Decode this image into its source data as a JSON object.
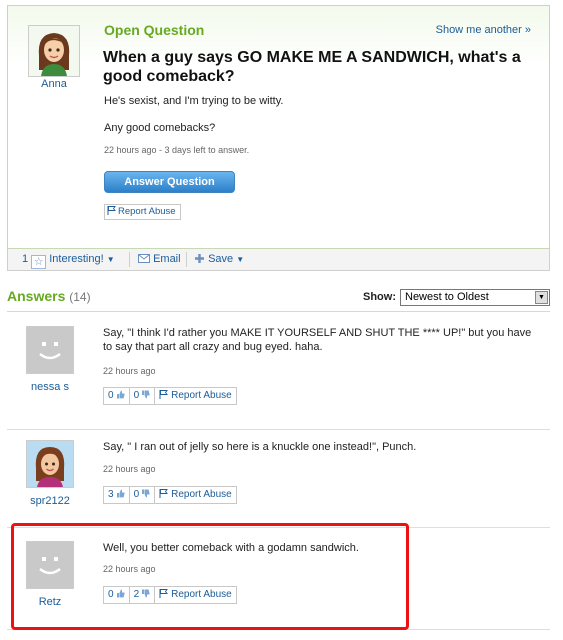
{
  "question": {
    "label": "Open Question",
    "show_another": "Show me another »",
    "asker": "Anna",
    "title": "When a guy says GO MAKE ME A SANDWICH, what's a good comeback?",
    "body_line1": "He's sexist, and I'm trying to be witty.",
    "body_line2": "Any good comebacks?",
    "meta": "22 hours ago - 3 days left to answer.",
    "answer_button": "Answer Question",
    "report": "Report Abuse"
  },
  "actions": {
    "interesting_count": "1",
    "interesting": "Interesting!",
    "email": "Email",
    "save": "Save"
  },
  "answers_header": {
    "title": "Answers",
    "count": "(14)",
    "show_label": "Show:",
    "sort_selected": "Newest to Oldest"
  },
  "answers": [
    {
      "user": "nessa s",
      "text": "Say, \"I think I'd rather you MAKE IT YOURSELF AND SHUT THE **** UP!\" but you have to say that part all crazy and bug eyed. haha.",
      "time": "22 hours ago",
      "thumbs_up": "0",
      "thumbs_down": "0",
      "report": "Report Abuse"
    },
    {
      "user": "spr2122",
      "text": "Say, \" I ran out of jelly so here is a knuckle one instead!\", Punch.",
      "time": "22 hours ago",
      "thumbs_up": "3",
      "thumbs_down": "0",
      "report": "Report Abuse"
    },
    {
      "user": "Retz",
      "text": "Well, you better comeback with a godamn sandwich.",
      "time": "22 hours ago",
      "thumbs_up": "0",
      "thumbs_down": "2",
      "report": "Report Abuse"
    }
  ],
  "colors": {
    "accent_green": "#66aa22",
    "link_blue": "#1b5c99",
    "highlight_red": "#ee1111"
  }
}
